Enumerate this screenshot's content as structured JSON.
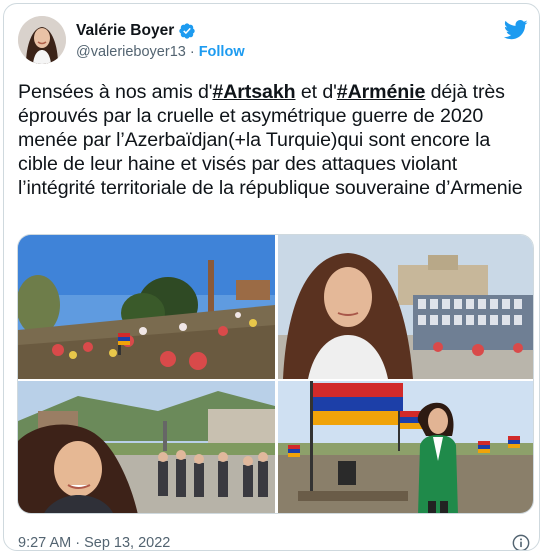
{
  "author": {
    "name": "Valérie Boyer",
    "handle": "@valerieboyer13",
    "separator": "·",
    "follow_label": "Follow",
    "verified": true
  },
  "tweet": {
    "text_parts": [
      "Pensées à nos amis d'",
      "#Artsakh",
      " et d'",
      "#Arménie",
      " déjà très éprouvés par la cruelle et asymétrique guerre de 2020 menée par l’Azerbaïdjan(+la Turquie)qui sont encore la cible de leur haine et visés par des attaques violant l’intégrité territoriale de la république souveraine d’Armenie"
    ]
  },
  "media": {
    "count": 4,
    "photos": [
      {
        "subject": "memorial cemetery with flowers and flags"
      },
      {
        "subject": "woman selfie in front of memorial wall with portraits"
      },
      {
        "subject": "woman selfie in town square with people"
      },
      {
        "subject": "woman in green jacket at cemetery with Armenian flags"
      }
    ]
  },
  "footer": {
    "timestamp": "9:27 AM · Sep 13, 2022"
  },
  "colors": {
    "accent": "#1d9bf0",
    "text": "#0f1419",
    "secondary": "#536471",
    "border": "#cfd9de"
  },
  "icons": [
    "verified-badge-icon",
    "twitter-bird-icon",
    "info-icon"
  ]
}
